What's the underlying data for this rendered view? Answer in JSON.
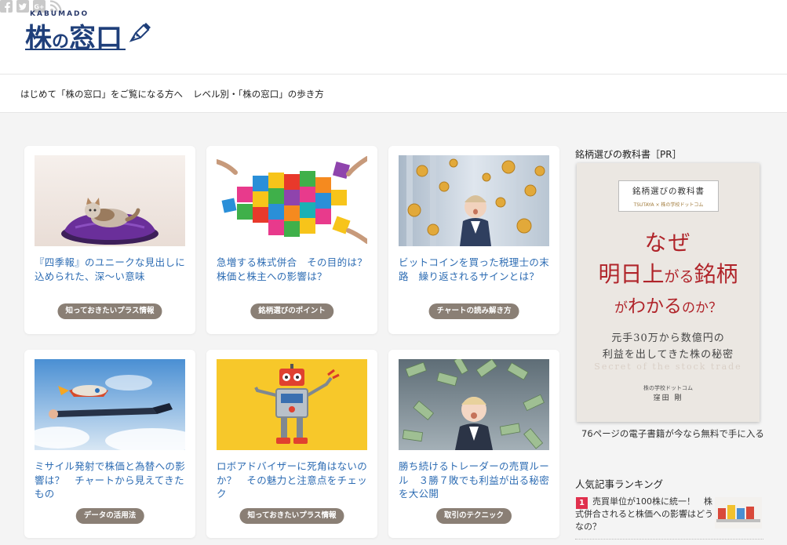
{
  "header": {
    "logo_small": "KABUMADO",
    "logo_kanji_a": "株",
    "logo_kana": "の",
    "logo_kanji_b": "窓口",
    "social": [
      {
        "name": "facebook-icon",
        "glyph": "f"
      },
      {
        "name": "twitter-icon",
        "glyph": "t"
      },
      {
        "name": "google-plus-icon",
        "glyph": "G+"
      },
      {
        "name": "rss-icon",
        "glyph": "rss"
      }
    ],
    "icon_color": "#c9c9c9"
  },
  "nav": {
    "items": [
      {
        "label": "はじめて「株の窓口」をご覧になる方へ"
      },
      {
        "label": "レベル別・「株の窓口」の歩き方"
      }
    ]
  },
  "cards": [
    {
      "title": "『四季報』のユニークな見出しに込められた、深〜い意味",
      "category": "知っておきたいプラス情報",
      "image": "cat-on-cushion"
    },
    {
      "title": "急増する株式併合　その目的は？　株価と株主への影響は？",
      "category": "銘柄選びのポイント",
      "image": "puzzle-pieces"
    },
    {
      "title": "ビットコインを買った税理士の末路　繰り返されるサインとは？",
      "category": "チャートの読み解き方",
      "image": "boy-with-coins"
    },
    {
      "title": "ミサイル発射で株価と為替への影響は？　チャートから見えてきたもの",
      "category": "データの活用法",
      "image": "man-riding-rocket"
    },
    {
      "title": "ロボアドバイザーに死角はないのか？　その魅力と注意点をチェック",
      "category": "知っておきたいプラス情報",
      "image": "toy-robot"
    },
    {
      "title": "勝ち続けるトレーダーの売買ルール　３勝７敗でも利益が出る秘密を大公開",
      "category": "取引のテクニック",
      "image": "child-with-money"
    }
  ],
  "sidebar": {
    "ad_title": "銘柄選びの教科書［PR］",
    "book": {
      "header_title": "銘柄選びの教科書",
      "header_sub": "TSUTAYA × 株の学校ドットコム",
      "line1": "なぜ",
      "line2_a": "明日上",
      "line2_b": "がる",
      "line2_c": "銘柄",
      "line3_a": "が",
      "line3_b": "わかる",
      "line3_c": "のか？",
      "line4": "元手30万から数億円の",
      "line5": "利益を出してきた株の秘密",
      "line6": "Secret of the stock trade",
      "publisher": "株の学校ドットコム",
      "author": "窪田 剛"
    },
    "ad_caption": "76ページの電子書籍が今なら無料で手に入る",
    "ranking_title": "人気記事ランキング",
    "ranking": [
      {
        "rank": "1",
        "title": "売買単位が100株に統一！　株式併合されると株価への影響はどうなの？"
      }
    ]
  },
  "colors": {
    "link": "#2d6cb3",
    "badge": "#8a7f75",
    "book_red": "#b0242a",
    "rank_red": "#e0304d",
    "logo_navy": "#1f3f7a"
  }
}
